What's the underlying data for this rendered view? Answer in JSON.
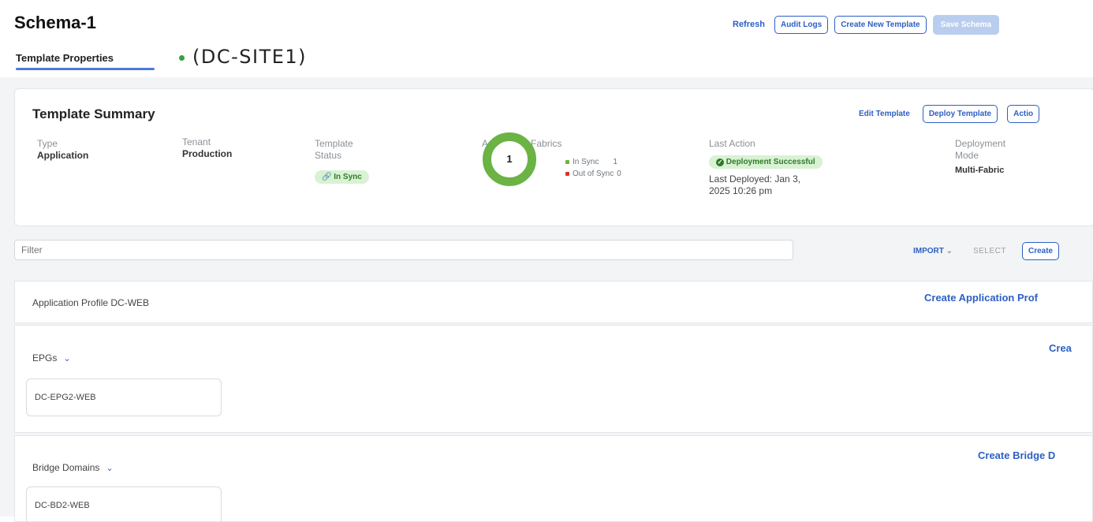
{
  "page": {
    "title": "Schema-1"
  },
  "tabs": {
    "template_properties": "Template Properties"
  },
  "site": {
    "label": "(DC-SITE1)"
  },
  "top_actions": {
    "refresh": "Refresh",
    "audit_logs": "Audit Logs",
    "create_template": "Create New Template",
    "save_schema": "Save Schema"
  },
  "summary": {
    "title": "Template Summary",
    "edit": "Edit Template",
    "deploy": "Deploy Template",
    "actions": "Actio",
    "type_label": "Type",
    "type_value": "Application",
    "tenant_label": "Tenant",
    "tenant_value": "Production",
    "status_label_1": "Template",
    "status_label_2": "Status",
    "status_value": "In Sync",
    "fabrics_label": "Associated Fabrics",
    "fabrics_count": "1",
    "in_sync_label": "In Sync",
    "in_sync_value": "1",
    "out_sync_label": "Out of Sync",
    "out_sync_value": "0",
    "last_action_label": "Last Action",
    "last_action_value": "Deployment Successful",
    "last_deployed_1": "Last Deployed: Jan 3,",
    "last_deployed_2": "2025 10:26 pm",
    "deploy_mode_label_1": "Deployment",
    "deploy_mode_label_2": "Mode",
    "deploy_mode_value": "Multi-Fabric"
  },
  "filter": {
    "placeholder": "Filter",
    "import": "IMPORT",
    "select": "SELECT",
    "create": "Create"
  },
  "sections": {
    "app_profile": {
      "title": "Application Profile DC-WEB",
      "action": "Create Application Prof"
    },
    "epgs": {
      "title": "EPGs",
      "action": "Crea",
      "items": [
        "DC-EPG2-WEB"
      ]
    },
    "bridge_domains": {
      "title": "Bridge Domains",
      "action": "Create Bridge D",
      "items": [
        "DC-BD2-WEB"
      ]
    }
  },
  "colors": {
    "accent": "#2d5fc4",
    "sync_green": "#6ab344",
    "error_red": "#d8352a"
  }
}
